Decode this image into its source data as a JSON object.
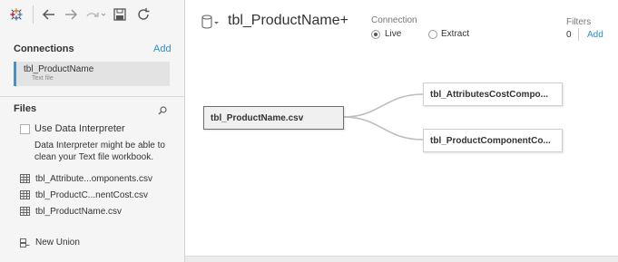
{
  "toolbar": {
    "logo_icon": "tableau-logo-icon",
    "back_icon": "arrow-left-icon",
    "forward_icon": "arrow-right-icon",
    "redo_icon": "redo-icon",
    "save_icon": "save-icon",
    "refresh_icon": "refresh-icon"
  },
  "connections": {
    "heading": "Connections",
    "add_label": "Add",
    "items": [
      {
        "name": "tbl_ProductName",
        "type": "Text file"
      }
    ]
  },
  "files": {
    "heading": "Files",
    "search_icon": "search-icon",
    "interpreter": {
      "label": "Use Data Interpreter",
      "checked": false,
      "description": "Data Interpreter might be able to clean your Text file workbook."
    },
    "items": [
      {
        "label": "tbl_Attribute...omponents.csv",
        "icon": "table-grid-icon"
      },
      {
        "label": "tbl_ProductC...nentCost.csv",
        "icon": "table-grid-icon"
      },
      {
        "label": "tbl_ProductName.csv",
        "icon": "table-grid-icon"
      }
    ],
    "new_union_label": "New Union"
  },
  "main": {
    "datasource_title": "tbl_ProductName+",
    "connection": {
      "label": "Connection",
      "options": [
        {
          "label": "Live",
          "selected": true
        },
        {
          "label": "Extract",
          "selected": false
        }
      ]
    },
    "filters": {
      "label": "Filters",
      "count": "0",
      "add_label": "Add"
    }
  },
  "canvas": {
    "primary_table": "tbl_ProductName.csv",
    "joined_tables": [
      "tbl_AttributesCostCompo...",
      "tbl_ProductComponentCo..."
    ]
  },
  "colors": {
    "accent": "#2c8fc9",
    "selected_bar": "#4a90c6",
    "sidebar_bg": "#f5f5f5"
  }
}
